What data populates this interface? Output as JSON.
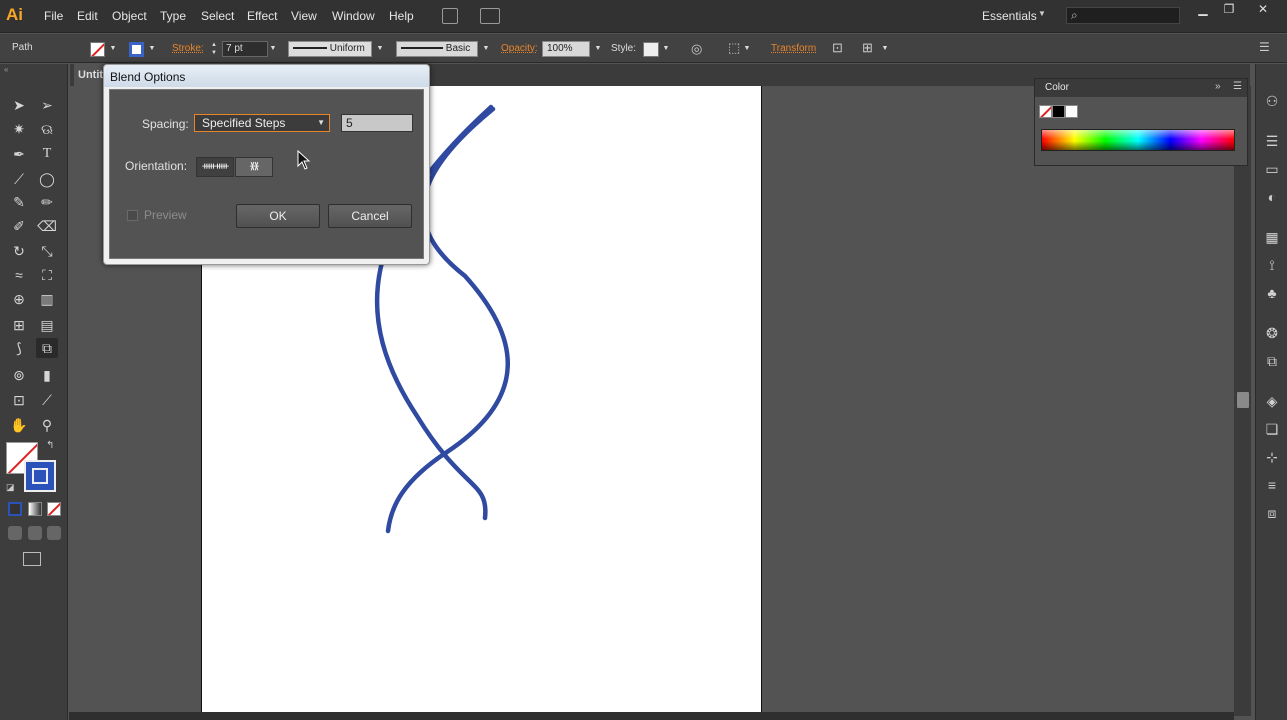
{
  "app": {
    "logo": "Ai"
  },
  "menu": [
    "File",
    "Edit",
    "Object",
    "Type",
    "Select",
    "Effect",
    "View",
    "Window",
    "Help"
  ],
  "workspace": {
    "label": "Essentials"
  },
  "control_bar": {
    "selection_type": "Path",
    "stroke_label": "Stroke:",
    "stroke_weight": "7 pt",
    "profile": "Uniform",
    "brush": "Basic",
    "opacity_label": "Opacity:",
    "opacity_value": "100%",
    "style_label": "Style:",
    "transform_label": "Transform"
  },
  "document": {
    "tab_title": "Untitled"
  },
  "color_panel": {
    "title": "Color"
  },
  "dialog": {
    "title": "Blend Options",
    "spacing_label": "Spacing:",
    "spacing_value": "Specified Steps",
    "steps_value": "5",
    "orientation_label": "Orientation:",
    "preview_label": "Preview",
    "preview_checked": false,
    "ok_label": "OK",
    "cancel_label": "Cancel"
  },
  "colors": {
    "accent": "#e8852b",
    "stroke": "#2f4aa0",
    "artboard": "#ffffff",
    "pasteboard": "#535353"
  },
  "icons": {
    "tools": [
      "selection-icon",
      "direct-selection-icon",
      "magic-wand-icon",
      "lasso-icon",
      "pen-icon",
      "type-icon",
      "line-icon",
      "ellipse-icon",
      "paintbrush-icon",
      "pencil-icon",
      "blob-brush-icon",
      "eraser-icon",
      "rotate-icon",
      "scale-icon",
      "warp-icon",
      "free-transform-icon",
      "shape-builder-icon",
      "perspective-grid-icon",
      "mesh-icon",
      "gradient-icon",
      "eyedropper-icon",
      "blend-icon",
      "symbol-sprayer-icon",
      "column-graph-icon",
      "artboard-icon",
      "slice-icon",
      "hand-icon",
      "zoom-icon"
    ]
  }
}
